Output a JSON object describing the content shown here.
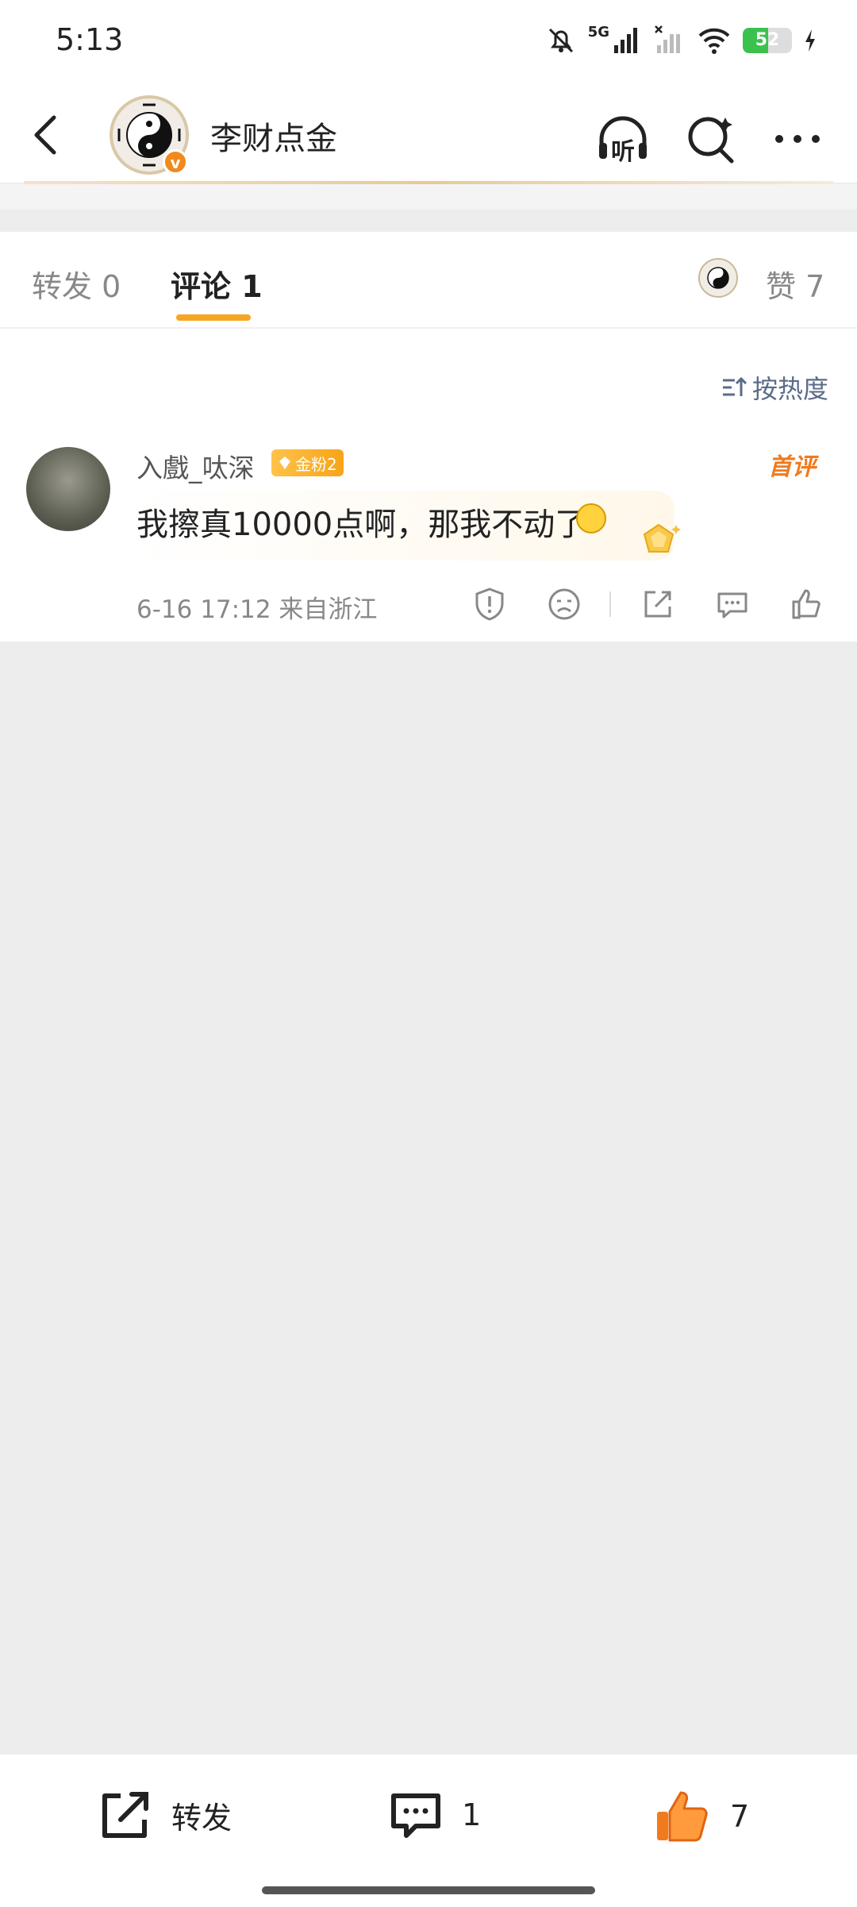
{
  "status_bar": {
    "time": "5:13",
    "network": "5G",
    "battery": "52"
  },
  "header": {
    "title": "李财点金",
    "listen_label": "听"
  },
  "tabs": {
    "repost": "转发 0",
    "comment": "评论 1",
    "likes": "赞 7"
  },
  "sort": {
    "label": "按热度"
  },
  "comment": {
    "user": "入戲_呔深",
    "fan_badge": "金粉2",
    "first_badge": "首评",
    "text": "我擦真10000点啊，那我不动了",
    "meta": "6-16 17:12 来自浙江"
  },
  "bottom_bar": {
    "repost_label": "转发",
    "comment_count": "1",
    "like_count": "7"
  },
  "colors": {
    "accent": "#f5a623",
    "like": "#f07b1d",
    "link": "#5b6b8a"
  }
}
